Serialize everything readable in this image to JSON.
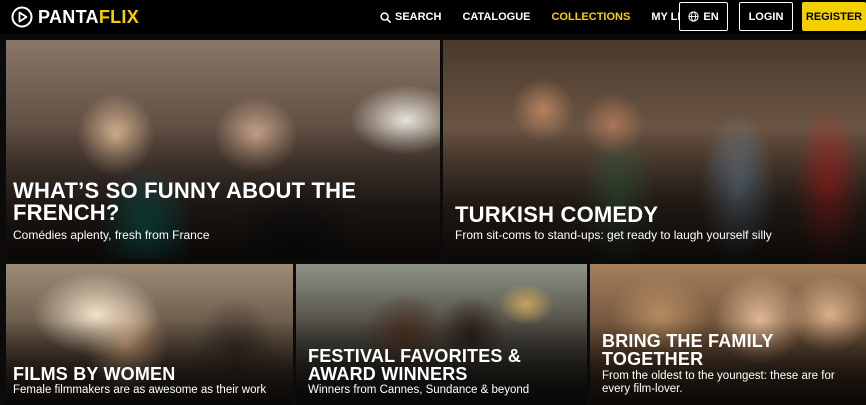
{
  "brand": {
    "name_part1": "PANTA",
    "name_part2": "FLIX",
    "accent": "#f5d000"
  },
  "nav": {
    "search": "SEARCH",
    "catalogue": "CATALOGUE",
    "collections": "COLLECTIONS",
    "my_lists": "MY LISTS"
  },
  "header_buttons": {
    "language": "EN",
    "login": "LOGIN",
    "register": "REGISTER"
  },
  "icons": {
    "logo": "play-circle-icon",
    "search": "search-icon",
    "language": "globe-icon"
  },
  "collections": [
    {
      "title": "WHAT’S SO FUNNY ABOUT THE FRENCH?",
      "subtitle": "Comédies aplenty, fresh from France"
    },
    {
      "title": "TURKISH COMEDY",
      "subtitle": "From sit-coms to stand-ups: get ready to laugh yourself silly"
    },
    {
      "title": "FILMS BY WOMEN",
      "subtitle": "Female filmmakers are as awesome as their work"
    },
    {
      "title": "FESTIVAL FAVORITES & AWARD WINNERS",
      "subtitle": "Winners from Cannes, Sundance & beyond"
    },
    {
      "title": "BRING THE FAMILY TOGETHER",
      "subtitle": "From the oldest to the youngest: these are for every film-lover."
    }
  ]
}
